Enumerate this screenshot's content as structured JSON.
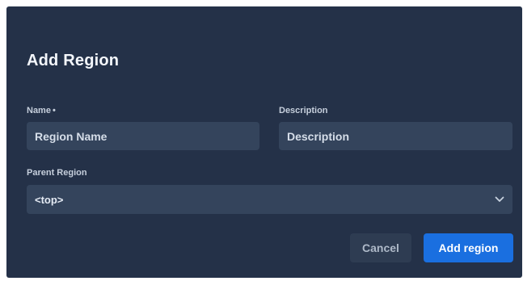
{
  "dialog": {
    "title": "Add Region",
    "fields": {
      "name": {
        "label": "Name",
        "required_marker": "•",
        "placeholder": "Region Name",
        "value": ""
      },
      "description": {
        "label": "Description",
        "placeholder": "Description",
        "value": ""
      },
      "parent_region": {
        "label": "Parent Region",
        "selected": "<top>"
      }
    },
    "buttons": {
      "cancel": "Cancel",
      "submit": "Add region"
    }
  },
  "colors": {
    "dialog_background": "#243148",
    "input_background": "#34445c",
    "primary_button": "#1a6fe0",
    "cancel_button": "#2e3c52"
  },
  "icons": {
    "select_chevron": "chevron-down-icon"
  }
}
